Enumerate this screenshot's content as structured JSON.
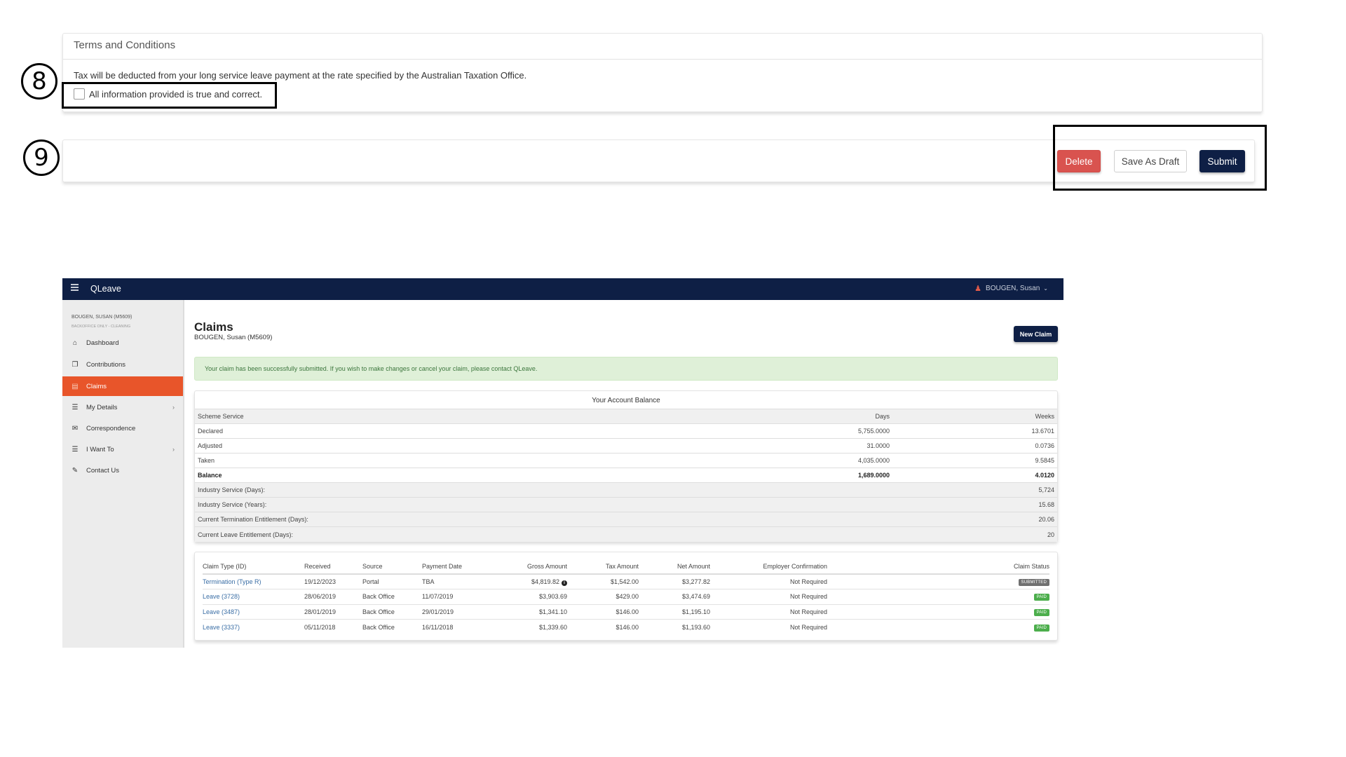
{
  "annotations": {
    "step_8": "8",
    "step_9": "9"
  },
  "terms": {
    "title": "Terms and Conditions",
    "tax_text": "Tax will be deducted from your long service leave payment at the rate specified by the Australian Taxation Office.",
    "agree_label": "All information provided is true and correct.",
    "agree_checked": false
  },
  "actions": {
    "delete_label": "Delete",
    "draft_label": "Save As Draft",
    "submit_label": "Submit"
  },
  "app": {
    "brand": "QLeave",
    "user_menu": "BOUGEN, Susan",
    "sidebar": {
      "user_name": "BOUGEN, SUSAN (M5609)",
      "user_role": "BACKOFFICE ONLY - CLEANING",
      "items": [
        {
          "label": "Dashboard",
          "icon": "home-icon",
          "active": false,
          "has_submenu": false
        },
        {
          "label": "Contributions",
          "icon": "copy-icon",
          "active": false,
          "has_submenu": false
        },
        {
          "label": "Claims",
          "icon": "claims-icon",
          "active": true,
          "has_submenu": false
        },
        {
          "label": "My Details",
          "icon": "list-icon",
          "active": false,
          "has_submenu": true
        },
        {
          "label": "Correspondence",
          "icon": "envelope-icon",
          "active": false,
          "has_submenu": false
        },
        {
          "label": "I Want To",
          "icon": "list-icon",
          "active": false,
          "has_submenu": true
        },
        {
          "label": "Contact Us",
          "icon": "pencil-icon",
          "active": false,
          "has_submenu": false
        }
      ]
    },
    "page": {
      "title": "Claims",
      "subtitle": "BOUGEN, Susan (M5609)",
      "new_claim_label": "New Claim",
      "alert": "Your claim has been successfully submitted. If you wish to make changes or cancel your claim, please contact QLeave."
    },
    "balance": {
      "title": "Your Account Balance",
      "header": {
        "label": "Scheme Service",
        "days": "Days",
        "weeks": "Weeks"
      },
      "rows": [
        {
          "label": "Declared",
          "days": "5,755.0000",
          "weeks": "13.6701"
        },
        {
          "label": "Adjusted",
          "days": "31.0000",
          "weeks": "0.0736"
        },
        {
          "label": "Taken",
          "days": "4,035.0000",
          "weeks": "9.5845"
        },
        {
          "label": "Balance",
          "days": "1,689.0000",
          "weeks": "4.0120"
        }
      ],
      "summary": [
        {
          "label": "Industry Service (Days):",
          "value": "5,724"
        },
        {
          "label": "Industry Service (Years):",
          "value": "15.68"
        },
        {
          "label": "Current Termination Entitlement (Days):",
          "value": "20.06"
        },
        {
          "label": "Current Leave Entitlement (Days):",
          "value": "20"
        }
      ]
    },
    "claims": {
      "columns": [
        "Claim Type (ID)",
        "Received",
        "Source",
        "Payment Date",
        "Gross Amount",
        "Tax Amount",
        "Net Amount",
        "Employer Confirmation",
        "Claim Status"
      ],
      "rows": [
        {
          "type": "Termination (Type R)",
          "received": "19/12/2023",
          "source": "Portal",
          "payment_date": "TBA",
          "gross": "$4,819.82",
          "gross_info": true,
          "tax": "$1,542.00",
          "net": "$3,277.82",
          "employer": "Not Required",
          "status": "SUBMITTED"
        },
        {
          "type": "Leave (3728)",
          "received": "28/06/2019",
          "source": "Back Office",
          "payment_date": "11/07/2019",
          "gross": "$3,903.69",
          "gross_info": false,
          "tax": "$429.00",
          "net": "$3,474.69",
          "employer": "Not Required",
          "status": "PAID"
        },
        {
          "type": "Leave (3487)",
          "received": "28/01/2019",
          "source": "Back Office",
          "payment_date": "29/01/2019",
          "gross": "$1,341.10",
          "gross_info": false,
          "tax": "$146.00",
          "net": "$1,195.10",
          "employer": "Not Required",
          "status": "PAID"
        },
        {
          "type": "Leave (3337)",
          "received": "05/11/2018",
          "source": "Back Office",
          "payment_date": "16/11/2018",
          "gross": "$1,339.60",
          "gross_info": false,
          "tax": "$146.00",
          "net": "$1,193.60",
          "employer": "Not Required",
          "status": "PAID"
        }
      ]
    }
  },
  "colors": {
    "navy": "#0e1f45",
    "active_orange": "#e8552a",
    "delete_red": "#d9534f",
    "success_bg": "#dff0d8",
    "paid_green": "#4cae4c",
    "submitted_grey": "#6f6f6f",
    "link_blue": "#3a6ea5"
  }
}
